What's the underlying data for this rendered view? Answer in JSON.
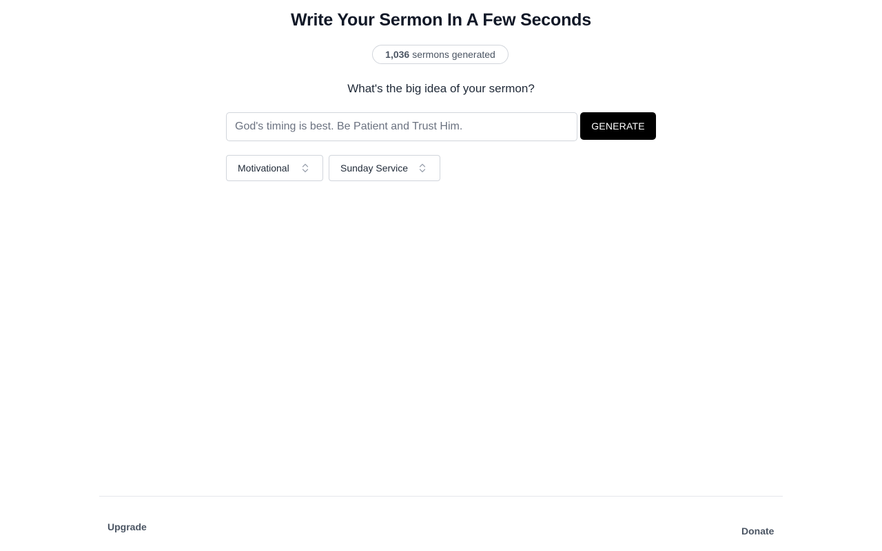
{
  "header": {
    "title": "Write Your Sermon In A Few Seconds"
  },
  "counter": {
    "count": "1,036",
    "label": "sermons generated"
  },
  "form": {
    "question": "What's the big idea of your sermon?",
    "idea_placeholder": "God's timing is best. Be Patient and Trust Him.",
    "idea_value": "",
    "generate_label": "GENERATE",
    "style_select": {
      "selected": "Motivational",
      "icon": "chevron-up-down-icon"
    },
    "occasion_select": {
      "selected": "Sunday Service",
      "icon": "chevron-up-down-icon"
    }
  },
  "footer": {
    "upgrade_label": "Upgrade",
    "donate_label": "Donate"
  },
  "colors": {
    "button_bg": "#000000",
    "button_text": "#ffffff",
    "border": "#d1d5db",
    "title": "#111827",
    "muted_text": "#4b5563"
  }
}
